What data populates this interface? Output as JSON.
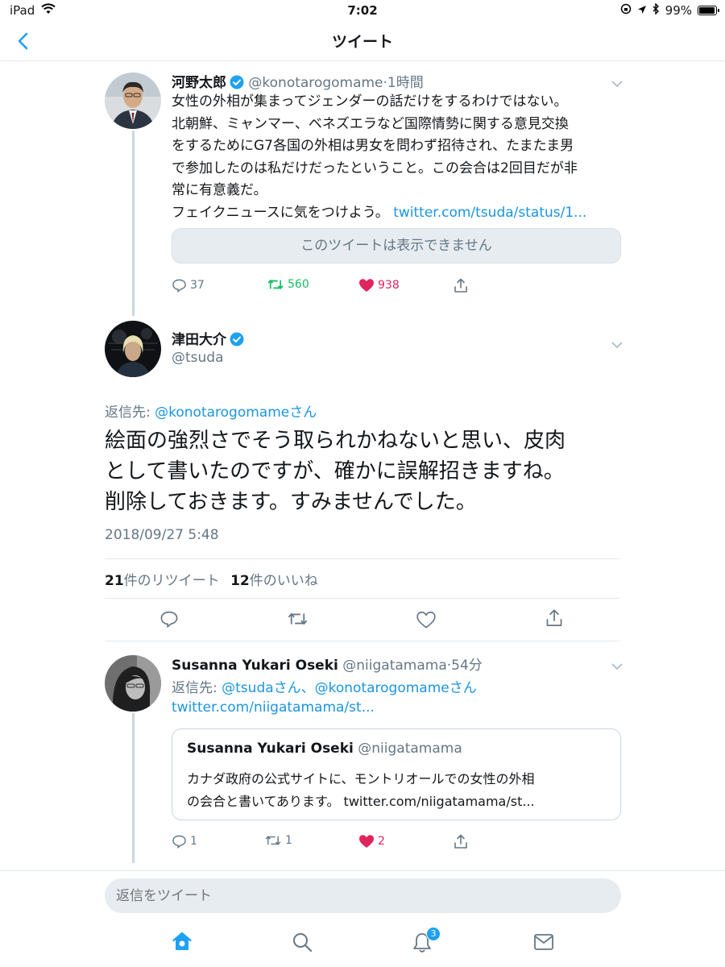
{
  "status": {
    "device": "iPad",
    "time": "7:02",
    "battery": "99%"
  },
  "nav": {
    "title": "ツイート"
  },
  "tweet1": {
    "name": "河野太郎",
    "handle": "@konotarogomame",
    "time": "·1時間",
    "lines": [
      "女性の外相が集まってジェンダーの話だけをするわけではない。",
      "北朝鮮、ミャンマー、ベネズエラなど国際情勢に関する意見交換",
      "をするためにG7各国の外相は男女を問わず招待され、たまたま男",
      "で参加したのは私だけだったということ。この会合は2回目だが非",
      "常に有意義だ。"
    ],
    "last_line": "フェイクニュースに気をつけよう。",
    "link": "twitter.com/tsuda/status/1...",
    "unavailable": "このツイートは表示できません",
    "replies": "37",
    "retweets": "560",
    "likes": "938"
  },
  "main": {
    "name": "津田大介",
    "handle": "@tsuda",
    "reply_to_label": "返信先:",
    "reply_to_handle": "@konotarogomameさん",
    "lines": [
      "絵面の強烈さでそう取られかねないと思い、皮肉",
      "として書いたのですが、確かに誤解招きますね。",
      "削除しておきます。すみませんでした。"
    ],
    "timestamp": "2018/09/27 5:48",
    "rt_count": "21",
    "rt_label": "件のリツイート",
    "like_count": "12",
    "like_label": "件のいいね"
  },
  "reply": {
    "name": "Susanna Yukari Oseki",
    "handle": "@niigatamama",
    "time": "·54分",
    "reply_to_label": "返信先:",
    "reply_to_handles": "@tsudaさん、@konotarogomameさん",
    "link": "twitter.com/niigatamama/st...",
    "quote": {
      "name": "Susanna Yukari Oseki",
      "handle": "@niigatamama",
      "line1": "カナダ政府の公式サイトに、モントリオールでの女性の外相",
      "line2_text": "の会合と書いてあります。",
      "line2_link": "twitter.com/niigatamama/st..."
    },
    "replies": "1",
    "retweets": "1",
    "likes": "2"
  },
  "composer": {
    "placeholder": "返信をツイート"
  },
  "tabbar": {
    "notifications_badge": "3"
  },
  "colors": {
    "accent": "#1da1f2",
    "link": "#1b95e0",
    "like": "#e0245e",
    "retweet": "#17bf63",
    "muted": "#657786"
  }
}
